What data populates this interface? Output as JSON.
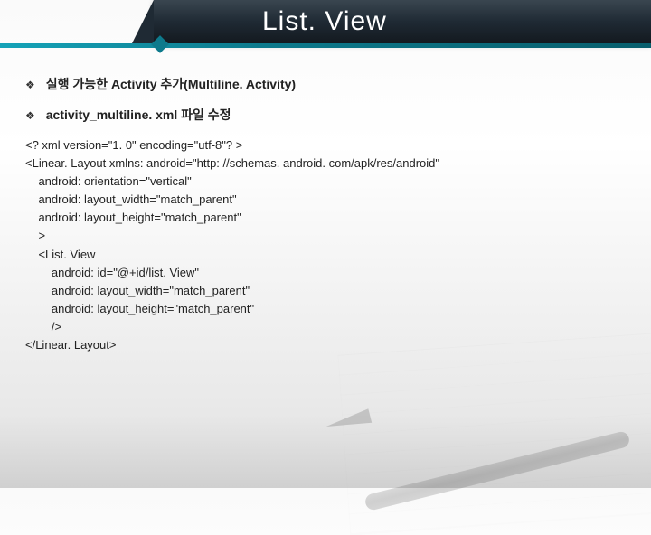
{
  "header": {
    "title": "List. View"
  },
  "bullets": [
    {
      "text": "실행 가능한 Activity 추가(Multiline. Activity)"
    },
    {
      "text": "activity_multiline. xml 파일 수정"
    }
  ],
  "code": "<? xml version=\"1. 0\" encoding=\"utf-8\"? >\n<Linear. Layout xmlns: android=\"http: //schemas. android. com/apk/res/android\"\n    android: orientation=\"vertical\"\n    android: layout_width=\"match_parent\"\n    android: layout_height=\"match_parent\"\n    >\n    <List. View\n        android: id=\"@+id/list. View\"\n        android: layout_width=\"match_parent\"\n        android: layout_height=\"match_parent\"\n        />\n</Linear. Layout>"
}
